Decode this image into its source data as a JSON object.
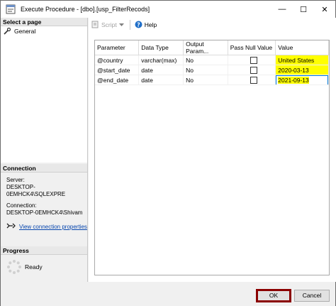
{
  "window": {
    "title": "Execute Procedure - [dbo].[usp_FilterRecods]",
    "minimize": "—",
    "maximize": "☐",
    "close": "✕"
  },
  "left_panel": {
    "select_page_header": "Select a page",
    "pages": [
      {
        "label": "General",
        "icon": "wrench-icon"
      }
    ],
    "connection_header": "Connection",
    "server_label": "Server:",
    "server_value": "DESKTOP-0EMHCK4\\SQLEXPRE",
    "connection_label": "Connection:",
    "connection_value": "DESKTOP-0EMHCK4\\Shivam",
    "view_link": "View connection properties",
    "progress_header": "Progress",
    "progress_status": "Ready"
  },
  "toolbar": {
    "script_label": "Script",
    "help_label": "Help"
  },
  "grid": {
    "columns": [
      "Parameter",
      "Data Type",
      "Output Param...",
      "Pass Null Value",
      "Value"
    ],
    "rows": [
      {
        "parameter": "@country",
        "data_type": "varchar(max)",
        "output": "No",
        "pass_null": false,
        "value": "United States"
      },
      {
        "parameter": "@start_date",
        "data_type": "date",
        "output": "No",
        "pass_null": false,
        "value": "2020-03-13"
      },
      {
        "parameter": "@end_date",
        "data_type": "date",
        "output": "No",
        "pass_null": false,
        "value": "2021-09-13"
      }
    ]
  },
  "buttons": {
    "ok": "OK",
    "cancel": "Cancel"
  },
  "colors": {
    "highlight": "#ffff00",
    "ok_border": "#8b0000",
    "link": "#0645ad"
  }
}
